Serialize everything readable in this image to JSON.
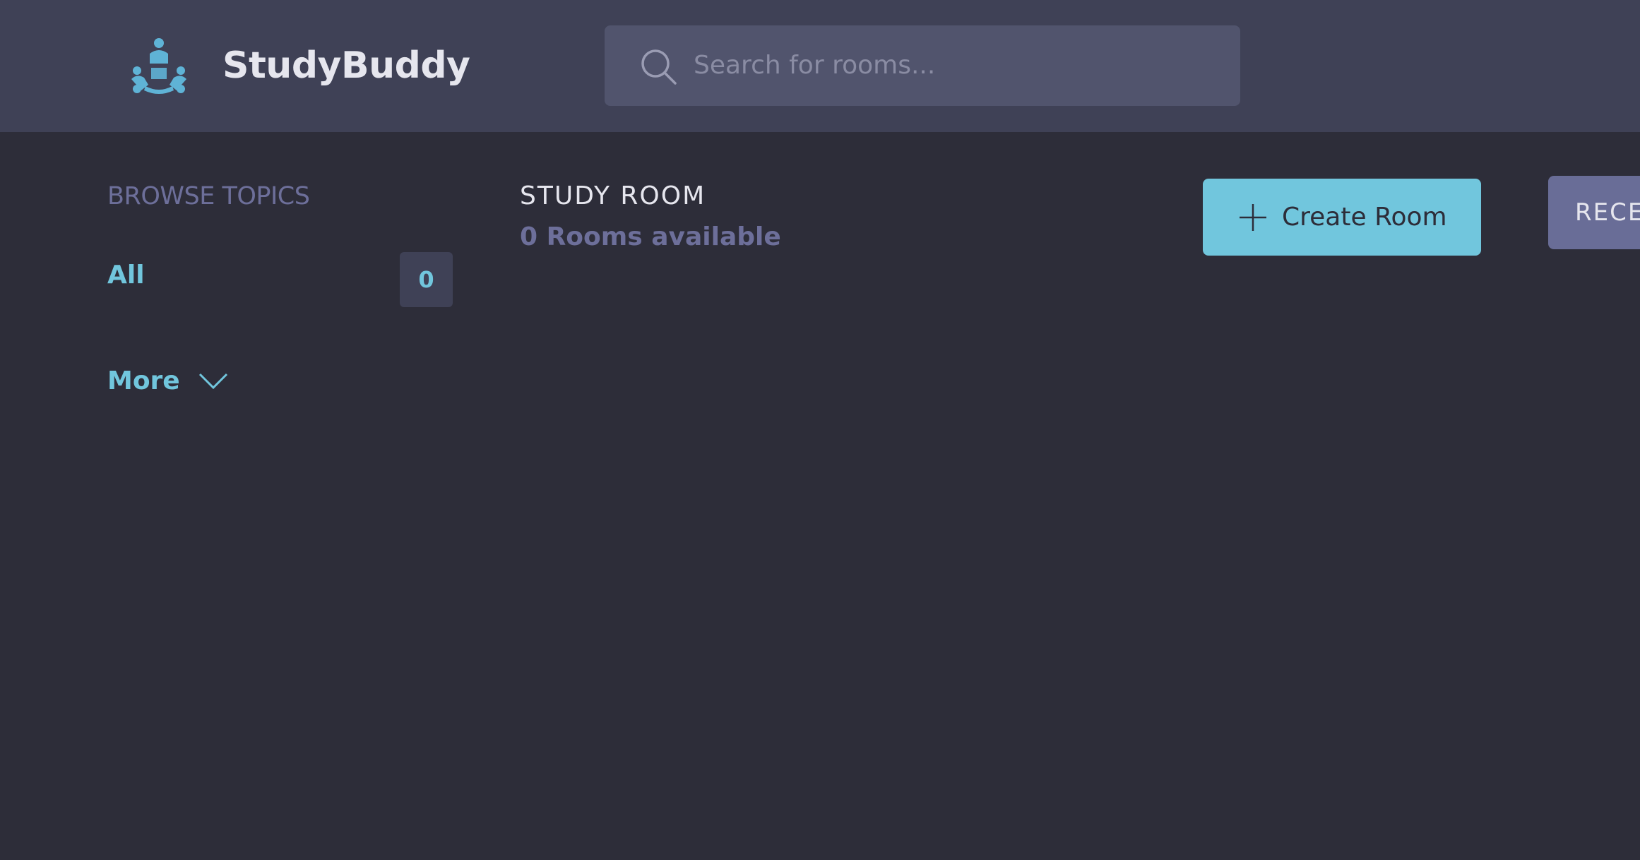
{
  "header": {
    "brand": "StudyBuddy",
    "logo_icon": "people-group-icon",
    "search": {
      "placeholder": "Search for rooms...",
      "value": "",
      "icon": "search-icon"
    }
  },
  "sidebar": {
    "title": "BROWSE TOPICS",
    "topics": [
      {
        "label": "All",
        "count": "0"
      }
    ],
    "more_label": "More",
    "more_icon": "chevron-down-icon"
  },
  "main": {
    "title": "STUDY ROOM",
    "rooms_available": "0 Rooms available",
    "create_button": {
      "label": "Create Room",
      "icon": "plus-icon"
    }
  },
  "activity": {
    "title_visible": "RECE"
  },
  "colors": {
    "header_bg": "#3f4156",
    "page_bg": "#2d2d39",
    "accent": "#71c6dd",
    "muted": "#6d6f9a",
    "search_bg": "#51546d",
    "recent_bg": "#696d97"
  }
}
